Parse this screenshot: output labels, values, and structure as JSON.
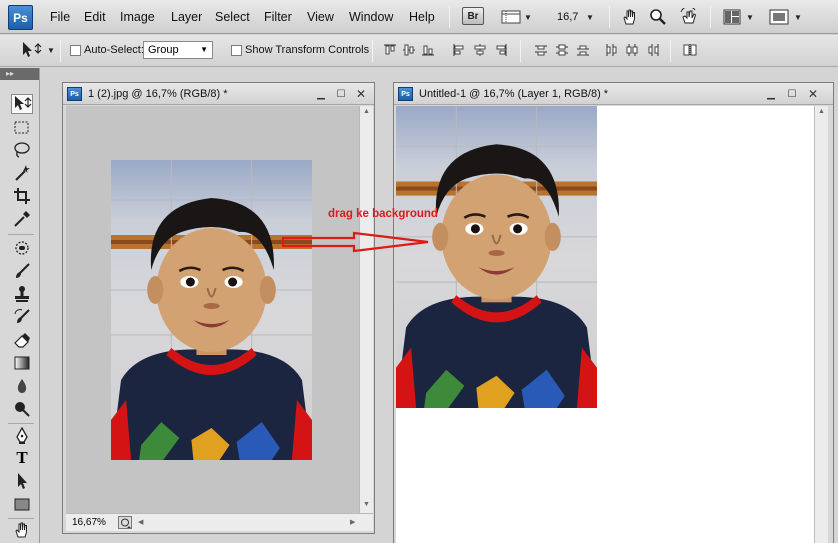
{
  "app": {
    "logo": "Ps",
    "menu": [
      "File",
      "Edit",
      "Image",
      "Layer",
      "Select",
      "Filter",
      "View",
      "Window",
      "Help"
    ],
    "bridge_label": "Br",
    "zoom_value": "16,7"
  },
  "options_bar": {
    "auto_select_label": "Auto-Select:",
    "auto_select_checked": false,
    "auto_select_mode": "Group",
    "show_transform_label": "Show Transform Controls",
    "show_transform_checked": false
  },
  "tools_panel": {
    "header": "▸▸",
    "tools": [
      "move-tool",
      "marquee-tool",
      "lasso-tool",
      "magic-wand-tool",
      "crop-tool",
      "eyedropper-tool",
      "spot-healing-tool",
      "brush-tool",
      "clone-stamp-tool",
      "history-brush-tool",
      "eraser-tool",
      "gradient-tool",
      "blur-tool",
      "dodge-tool",
      "pen-tool",
      "type-tool",
      "path-selection-tool",
      "shape-tool",
      "hand-tool"
    ],
    "active_tool": "move-tool",
    "type_glyph": "T"
  },
  "documents": [
    {
      "title": "1 (2).jpg @ 16,7% (RGB/8) *",
      "zoom_status": "16,67%"
    },
    {
      "title": "Untitled-1 @ 16,7% (Layer 1, RGB/8) *"
    }
  ],
  "annotation": {
    "text": "drag ke background",
    "color": "#e01818"
  }
}
